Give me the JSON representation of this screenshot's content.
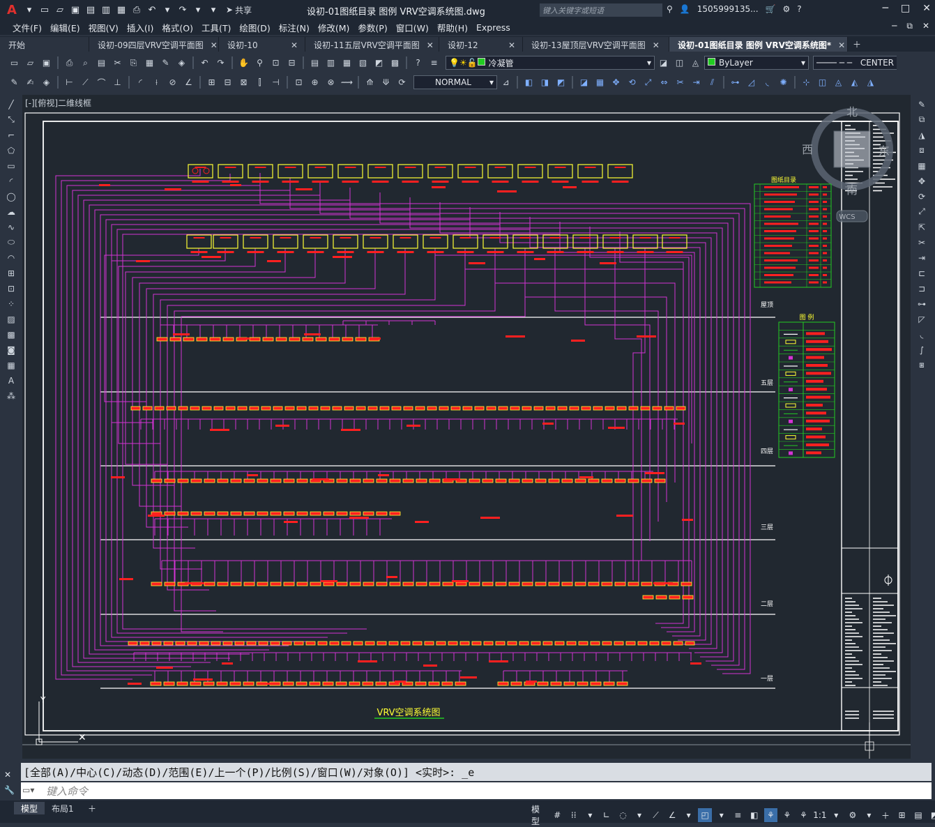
{
  "title_bar": {
    "share_label": "共享",
    "document_title": "设初-01图纸目录 图例 VRV空调系统图.dwg",
    "search_placeholder": "键入关键字或短语",
    "user_name": "1505999135..."
  },
  "menu": [
    "文件(F)",
    "编辑(E)",
    "视图(V)",
    "插入(I)",
    "格式(O)",
    "工具(T)",
    "绘图(D)",
    "标注(N)",
    "修改(M)",
    "参数(P)",
    "窗口(W)",
    "帮助(H)",
    "Express"
  ],
  "tabs": [
    {
      "label": "开始",
      "closable": false
    },
    {
      "label": "设初-09四层VRV空调平面图",
      "closable": true
    },
    {
      "label": "设初-10",
      "closable": true
    },
    {
      "label": "设初-11五层VRV空调平面图",
      "closable": true
    },
    {
      "label": "设初-12",
      "closable": true
    },
    {
      "label": "设初-13屋顶层VRV空调平面图",
      "closable": true
    },
    {
      "label": "设初-01图纸目录 图例 VRV空调系统图*",
      "closable": true,
      "active": true
    }
  ],
  "layers": {
    "current_layer": "冷凝管",
    "color": "ByLayer",
    "linetype": "CENTER",
    "text_style": "NORMAL",
    "layer_color_hex": "#22cc22"
  },
  "viewport": {
    "label": "[-][俯视]二维线框"
  },
  "drawing": {
    "floors": [
      "屋顶",
      "五层",
      "四层",
      "三层",
      "二层",
      "一层"
    ],
    "title": "VRV空调系统图",
    "catalog_title": "图纸目录",
    "legend_title": "图  例",
    "compass": {
      "n": "北",
      "s": "南",
      "e": "东",
      "w": "西",
      "wcs": "WCS"
    }
  },
  "command": {
    "history": "[全部(A)/中心(C)/动态(D)/范围(E)/上一个(P)/比例(S)/窗口(W)/对象(O)] <实时>: _e",
    "input_placeholder": "键入命令"
  },
  "status": {
    "layout_tabs": [
      "模型",
      "布局1"
    ],
    "model_label": "模型",
    "scale": "1:1"
  },
  "colors": {
    "magenta": "#d433d4",
    "yellow": "#ffff33",
    "red": "#ff2020",
    "green": "#22cc22",
    "white": "#ffffff"
  }
}
